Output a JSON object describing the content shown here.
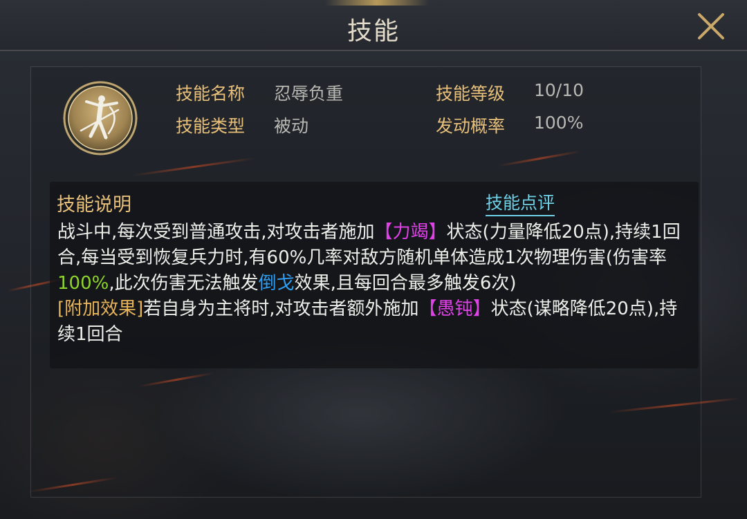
{
  "window": {
    "title": "技能"
  },
  "skill": {
    "name_label": "技能名称",
    "name_value": "忍辱负重",
    "type_label": "技能类型",
    "type_value": "被动",
    "level_label": "技能等级",
    "level_value": "10/10",
    "rate_label": "发动概率",
    "rate_value": "100%"
  },
  "description": {
    "heading": "技能说明",
    "review_link": "技能点评",
    "p1": "战斗中,每次受到普通攻击,对攻击者施加",
    "status1": "【力竭】",
    "p2": "状态(力量降低20点),持续1回合,每当受到恢复兵力时,有60%几率对敌方随机单体造成1次物理伤害(伤害率",
    "rate": "100%",
    "p3": ",此次伤害无法触发",
    "keyword": "倒戈",
    "p4": "效果,且每回合最多触发6次)",
    "extra_tag": "[附加效果]",
    "p5": "若自身为主将时,对攻击者额外施加",
    "status2": "【愚钝】",
    "p6": "状态(谋略降低20点),持续1回合"
  },
  "colors": {
    "label_gold": "#e8c07a",
    "value_gray": "#b9b9b4",
    "status_pink": "#e040e8",
    "rate_green": "#8ed42a",
    "keyword_blue": "#2f9df0",
    "link_cyan": "#6ed1e6"
  },
  "icons": {
    "close": "close-icon",
    "skill": "skill-emblem-icon"
  }
}
